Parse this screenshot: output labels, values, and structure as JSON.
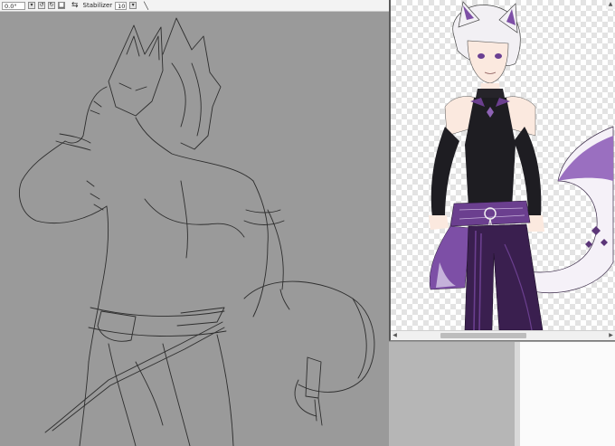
{
  "toolbar": {
    "angle_value": "0.0°",
    "stabilizer_label": "Stabilizer",
    "stabilizer_value": "10"
  },
  "icons": {
    "angle_dropdown": "chevron-down-icon",
    "rotate_ccw": "rotate-left-icon",
    "rotate_cw": "rotate-right-icon",
    "reset": "reset-icon",
    "flip": "flip-horizontal-icon",
    "stabilizer_dropdown": "chevron-down-icon",
    "pen": "pen-icon"
  },
  "colors": {
    "canvas_gray": "#9a9a9a",
    "accent_purple": "#6b3f8f",
    "outfit_black": "#1b1b1f"
  }
}
